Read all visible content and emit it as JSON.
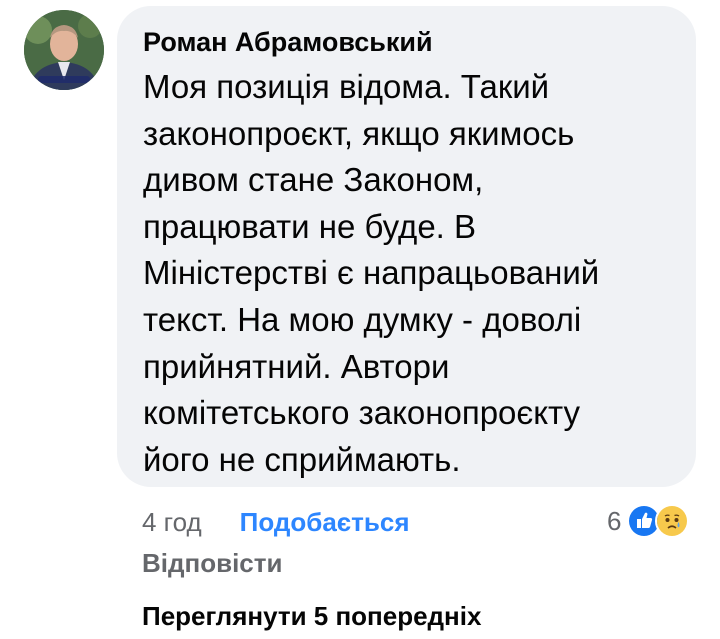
{
  "comment": {
    "author": "Роман Абрамовський",
    "text_lines": [
      "Моя позиція відома. Такий",
      "законопроєкт, якщо якимось",
      "дивом стане Законом,",
      "працювати не буде. В",
      "Міністерстві є напрацьований",
      "текст. На мою думку - доволі",
      "прийнятний. Автори",
      "комітетського законопроєкту",
      "його не сприймають."
    ],
    "time": "4 год",
    "like_label": "Подобається",
    "reply_label": "Відповісти",
    "reaction_count": "6",
    "reaction_icons": [
      "like-icon",
      "sad-icon"
    ]
  },
  "view_previous_label": "Переглянути 5 попередніх",
  "colors": {
    "bubble": "#f0f2f5",
    "like_link": "#2d86ff",
    "secondary_text": "#65676b",
    "primary_text": "#050505"
  }
}
